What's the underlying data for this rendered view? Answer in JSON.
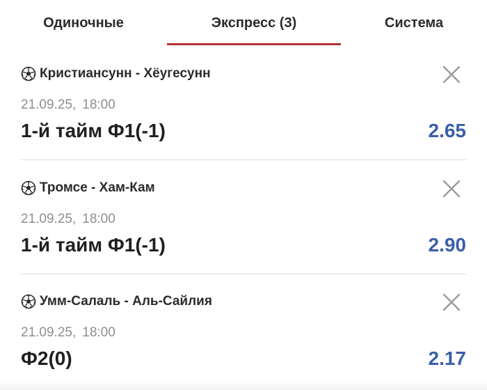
{
  "tabs": [
    {
      "label": "Одиночные",
      "active": false
    },
    {
      "label": "Экспресс (3)",
      "active": true
    },
    {
      "label": "Система",
      "active": false
    }
  ],
  "colors": {
    "accent_underline": "#b83236",
    "odds": "#3a5fa8",
    "date_text": "#8e8e8e",
    "close_icon": "#9a9a9a"
  },
  "bets": [
    {
      "sport_icon": "soccer-ball-icon",
      "match": "Кристиансунн - Хёугесунн",
      "date": "21.09.25,",
      "time": "18:00",
      "market": "1-й тайм Ф1(-1)",
      "odds": "2.65"
    },
    {
      "sport_icon": "soccer-ball-icon",
      "match": "Тромсе - Хам-Кам",
      "date": "21.09.25,",
      "time": "18:00",
      "market": "1-й тайм Ф1(-1)",
      "odds": "2.90"
    },
    {
      "sport_icon": "soccer-ball-icon",
      "match": "Умм-Салаль - Аль-Сайлия",
      "date": "21.09.25,",
      "time": "18:00",
      "market": "Ф2(0)",
      "odds": "2.17"
    }
  ]
}
